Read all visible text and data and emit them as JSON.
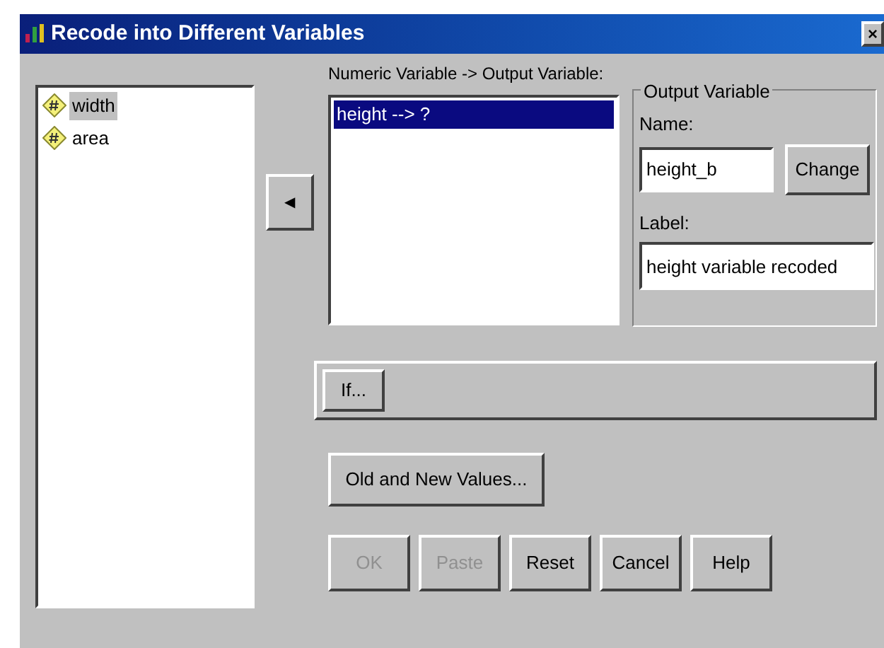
{
  "window": {
    "title": "Recode into Different Variables",
    "close": "×"
  },
  "source_variables": [
    {
      "name": "width",
      "selected": true
    },
    {
      "name": "area",
      "selected": false
    }
  ],
  "move_button": {
    "symbol": "◀"
  },
  "mapping_list": {
    "label": "Numeric Variable -> Output Variable:",
    "items": [
      {
        "text": "height --> ?",
        "selected": true
      }
    ]
  },
  "output_variable": {
    "title": "Output Variable",
    "name_label": "Name:",
    "name_value": "height_b",
    "change_button": "Change",
    "label_label": "Label:",
    "label_value": "height variable recoded"
  },
  "if_button": "If...",
  "old_new_button": "Old and New Values...",
  "buttons": [
    {
      "label": "OK",
      "disabled": true
    },
    {
      "label": "Paste",
      "disabled": true
    },
    {
      "label": "Reset",
      "disabled": false
    },
    {
      "label": "Cancel",
      "disabled": false
    },
    {
      "label": "Help",
      "disabled": false
    }
  ]
}
